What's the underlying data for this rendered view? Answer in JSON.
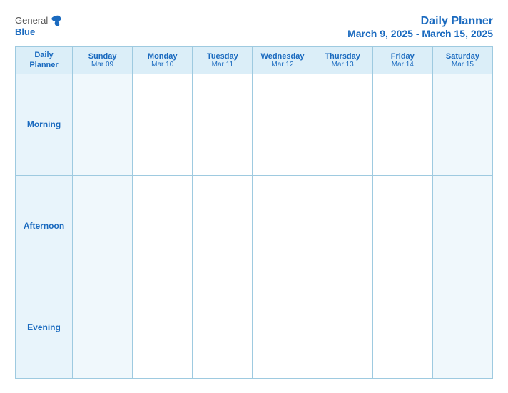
{
  "header": {
    "logo": {
      "general": "General",
      "blue": "Blue"
    },
    "title": "Daily Planner",
    "subtitle": "March 9, 2025 - March 15, 2025"
  },
  "table": {
    "corner_label_line1": "Daily",
    "corner_label_line2": "Planner",
    "columns": [
      {
        "day": "Sunday",
        "date": "Mar 09"
      },
      {
        "day": "Monday",
        "date": "Mar 10"
      },
      {
        "day": "Tuesday",
        "date": "Mar 11"
      },
      {
        "day": "Wednesday",
        "date": "Mar 12"
      },
      {
        "day": "Thursday",
        "date": "Mar 13"
      },
      {
        "day": "Friday",
        "date": "Mar 14"
      },
      {
        "day": "Saturday",
        "date": "Mar 15"
      }
    ],
    "rows": [
      {
        "label": "Morning"
      },
      {
        "label": "Afternoon"
      },
      {
        "label": "Evening"
      }
    ]
  }
}
